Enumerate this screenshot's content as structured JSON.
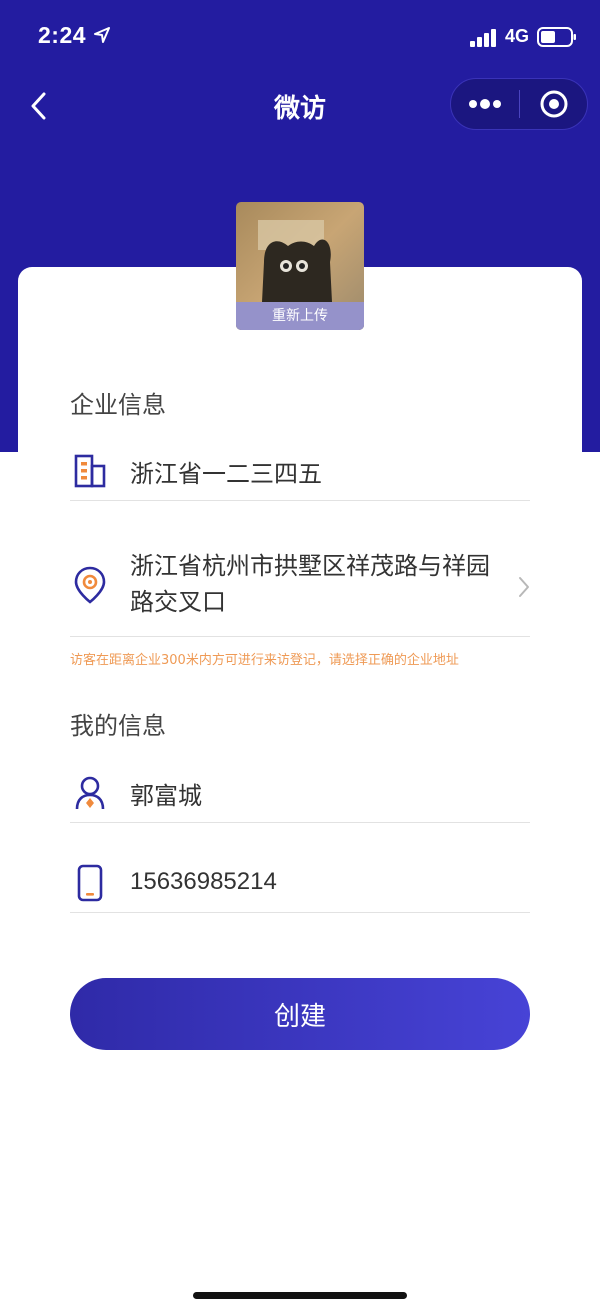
{
  "status_bar": {
    "time": "2:24",
    "network": "4G"
  },
  "nav": {
    "title": "微访"
  },
  "avatar": {
    "reupload_label": "重新上传"
  },
  "company_section": {
    "title": "企业信息",
    "name": "浙江省一二三四五",
    "address": "浙江省杭州市拱墅区祥茂路与祥园路交叉口",
    "hint": "访客在距离企业300米内方可进行来访登记，请选择正确的企业地址"
  },
  "my_section": {
    "title": "我的信息",
    "name": "郭富城",
    "phone": "15636985214"
  },
  "actions": {
    "create_label": "创建"
  },
  "colors": {
    "brand": "#231ca0",
    "accent": "#4743d6",
    "hint": "#ef9a55",
    "icon_orange": "#f08a3c"
  }
}
